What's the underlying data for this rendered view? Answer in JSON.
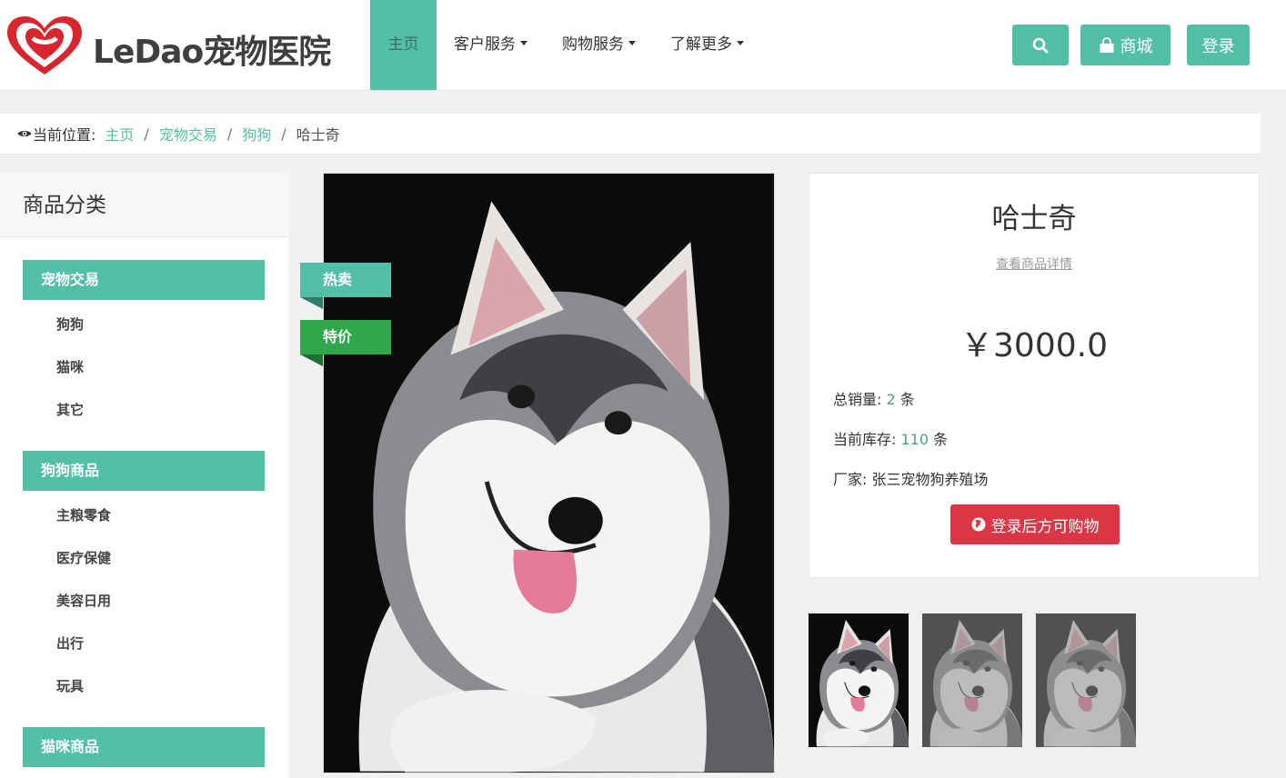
{
  "brand": {
    "logo_text": "LeDao宠物医院",
    "primary_color": "#52bfa7",
    "logo_color": "#d7262e"
  },
  "nav": {
    "items": [
      {
        "label": "主页",
        "active": true,
        "dropdown": false
      },
      {
        "label": "客户服务",
        "active": false,
        "dropdown": true
      },
      {
        "label": "购物服务",
        "active": false,
        "dropdown": true
      },
      {
        "label": "了解更多",
        "active": false,
        "dropdown": true
      }
    ],
    "search_icon": "search-icon",
    "mall_label": "商城",
    "mall_icon": "shopping-bag-icon",
    "login_label": "登录"
  },
  "breadcrumb": {
    "prefix": "当前位置:",
    "links": [
      "主页",
      "宠物交易",
      "狗狗"
    ],
    "current": "哈士奇",
    "separator": "/"
  },
  "sidebar": {
    "title": "商品分类",
    "categories": [
      {
        "title": "宠物交易",
        "items": [
          "狗狗",
          "猫咪",
          "其它"
        ]
      },
      {
        "title": "狗狗商品",
        "items": [
          "主粮零食",
          "医疗保健",
          "美容日用",
          "出行",
          "玩具"
        ]
      },
      {
        "title": "猫咪商品",
        "items": []
      }
    ]
  },
  "badges": {
    "hot": "热卖",
    "deal": "特价"
  },
  "product": {
    "name": "哈士奇",
    "detail_link": "查看商品详情",
    "price": "￥3000.0",
    "sales_label": "总销量:",
    "sales_value": "2",
    "sales_unit": "条",
    "stock_label": "当前库存:",
    "stock_value": "110",
    "stock_unit": "条",
    "maker_label": "厂家:",
    "maker_value": "张三宠物狗养殖场",
    "buy_label": "登录后方可购物",
    "buy_color": "#dc3545"
  },
  "thumbnails": {
    "count": 3,
    "selected_index": 0
  }
}
